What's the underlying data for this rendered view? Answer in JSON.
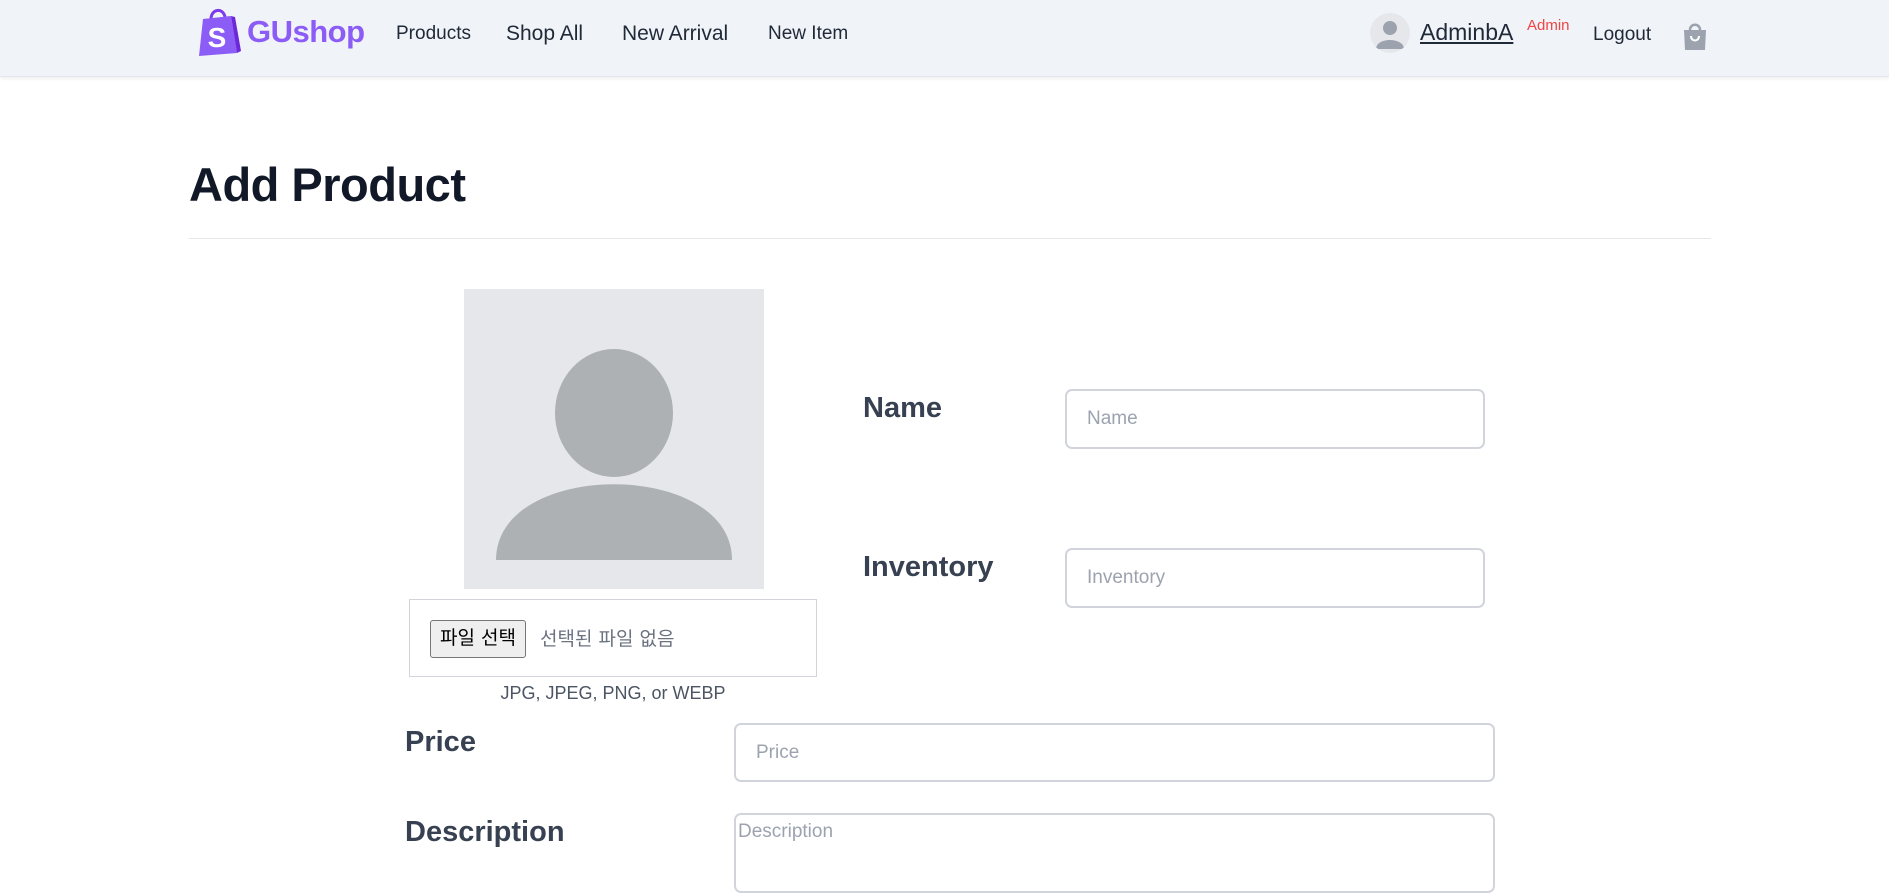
{
  "brand": {
    "name": "GUshop",
    "accent": "#8b5cf6",
    "icon": "shopping-bag-logo-icon"
  },
  "nav": {
    "links": [
      "Products",
      "Shop All",
      "New Arrival",
      "New Item"
    ]
  },
  "user": {
    "name": "AdminbA",
    "role": "Admin",
    "logout": "Logout",
    "cart_icon": "shopping-bag-icon"
  },
  "page": {
    "title": "Add Product"
  },
  "image_upload": {
    "preview_icon": "user-placeholder-icon",
    "button": "파일 선택",
    "status": "선택된 파일 없음",
    "hint": "JPG, JPEG, PNG, or WEBP"
  },
  "form": {
    "name": {
      "label": "Name",
      "placeholder": "Name",
      "value": ""
    },
    "inventory": {
      "label": "Inventory",
      "placeholder": "Inventory",
      "value": ""
    },
    "price": {
      "label": "Price",
      "placeholder": "Price",
      "value": ""
    },
    "description": {
      "label": "Description",
      "placeholder": "Description",
      "value": ""
    }
  }
}
